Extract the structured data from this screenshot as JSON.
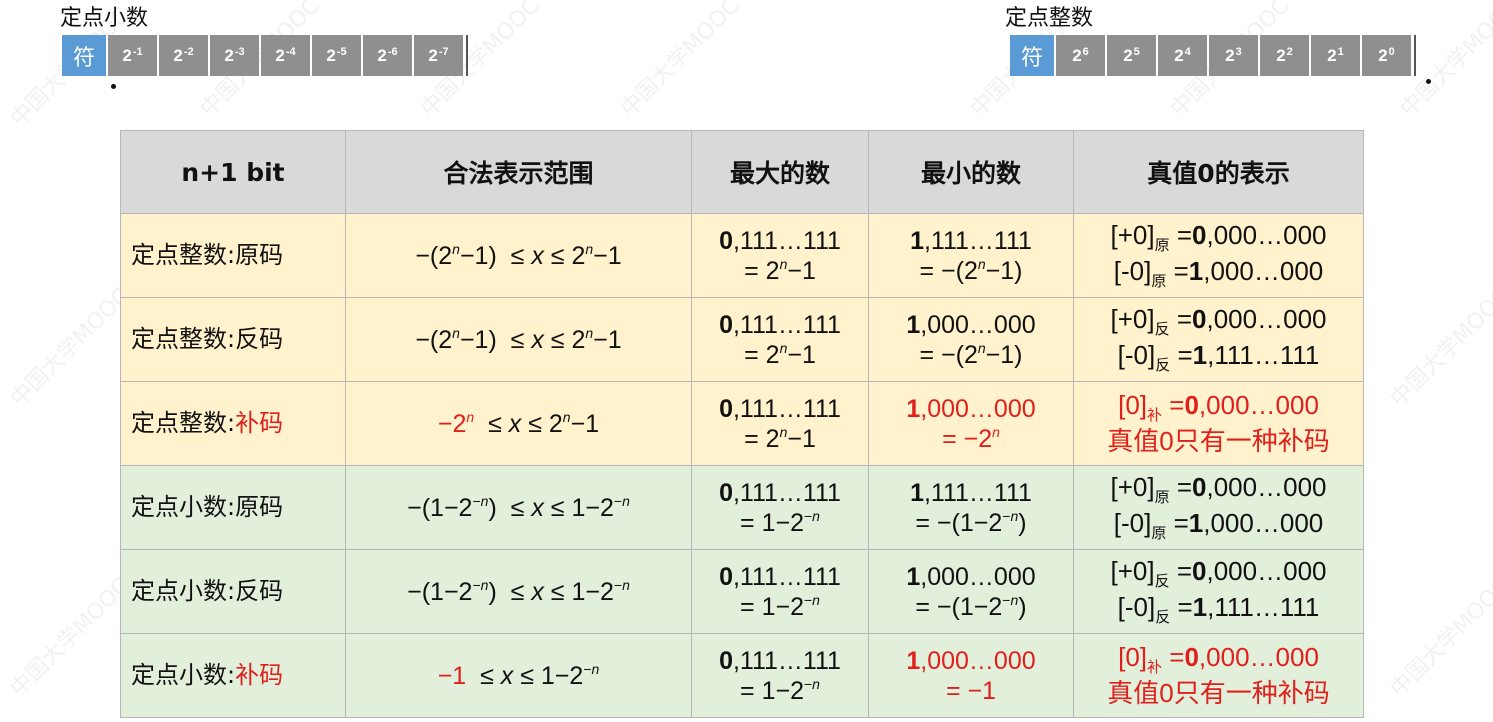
{
  "fixed_fraction": {
    "caption": "定点小数",
    "sign": "符",
    "bits": [
      {
        "base": "2",
        "exp": "-1"
      },
      {
        "base": "2",
        "exp": "-2"
      },
      {
        "base": "2",
        "exp": "-3"
      },
      {
        "base": "2",
        "exp": "-4"
      },
      {
        "base": "2",
        "exp": "-5"
      },
      {
        "base": "2",
        "exp": "-6"
      },
      {
        "base": "2",
        "exp": "-7"
      }
    ]
  },
  "fixed_integer": {
    "caption": "定点整数",
    "sign": "符",
    "bits": [
      {
        "base": "2",
        "exp": "6"
      },
      {
        "base": "2",
        "exp": "5"
      },
      {
        "base": "2",
        "exp": "4"
      },
      {
        "base": "2",
        "exp": "3"
      },
      {
        "base": "2",
        "exp": "2"
      },
      {
        "base": "2",
        "exp": "1"
      },
      {
        "base": "2",
        "exp": "0"
      }
    ]
  },
  "table": {
    "headers": [
      "n+1 bit",
      "合法表示范围",
      "最大的数",
      "最小的数",
      "真值0的表示"
    ],
    "rows": [
      {
        "name_a": "定点整数:",
        "name_b": "原码"
      },
      {
        "name_a": "定点整数:",
        "name_b": "反码"
      },
      {
        "name_a": "定点整数:",
        "name_b": "补码"
      },
      {
        "name_a": "定点小数:",
        "name_b": "原码"
      },
      {
        "name_a": "定点小数:",
        "name_b": "反码"
      },
      {
        "name_a": "定点小数:",
        "name_b": "补码"
      }
    ]
  },
  "watermark": "中国大学MOOC"
}
